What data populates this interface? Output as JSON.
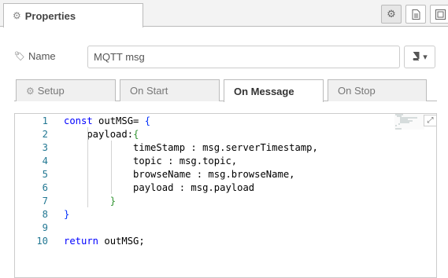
{
  "header": {
    "tab_label": "Properties",
    "tab_icon": "gear-icon"
  },
  "toolbar": {
    "buttons": [
      {
        "name": "settings-gear-icon",
        "active": true
      },
      {
        "name": "description-document-icon",
        "active": false
      },
      {
        "name": "appearance-frame-icon",
        "active": false
      }
    ]
  },
  "form": {
    "name_label": "Name",
    "name_value": "MQTT msg",
    "icon_button": "book-icon"
  },
  "tabs": [
    {
      "label": "Setup",
      "icon": "gear-icon",
      "active": false
    },
    {
      "label": "On Start",
      "active": false
    },
    {
      "label": "On Message",
      "active": true
    },
    {
      "label": "On Stop",
      "active": false
    }
  ],
  "editor": {
    "line_numbers": [
      "1",
      "2",
      "3",
      "4",
      "5",
      "6",
      "7",
      "8",
      "9",
      "10"
    ],
    "lines": [
      [
        {
          "t": "const",
          "c": "kw"
        },
        {
          "t": " outMSG= ",
          "c": ""
        },
        {
          "t": "{",
          "c": "br1"
        }
      ],
      [
        {
          "t": "    payload:",
          "c": ""
        },
        {
          "t": "{",
          "c": "br2"
        }
      ],
      [
        {
          "t": "            timeStamp : msg.serverTimestamp,",
          "c": ""
        }
      ],
      [
        {
          "t": "            topic : msg.topic,",
          "c": ""
        }
      ],
      [
        {
          "t": "            browseName : msg.browseName,",
          "c": ""
        }
      ],
      [
        {
          "t": "            payload : msg.payload",
          "c": ""
        }
      ],
      [
        {
          "t": "        ",
          "c": ""
        },
        {
          "t": "}",
          "c": "br2"
        }
      ],
      [
        {
          "t": "}",
          "c": "br1"
        }
      ],
      [],
      [
        {
          "t": "return",
          "c": "kw"
        },
        {
          "t": " outMSG;",
          "c": ""
        }
      ]
    ]
  },
  "colors": {
    "keyword": "#0000ff",
    "bracket_level1": "#0431fa",
    "bracket_level2": "#319331",
    "line_number": "#237893"
  }
}
